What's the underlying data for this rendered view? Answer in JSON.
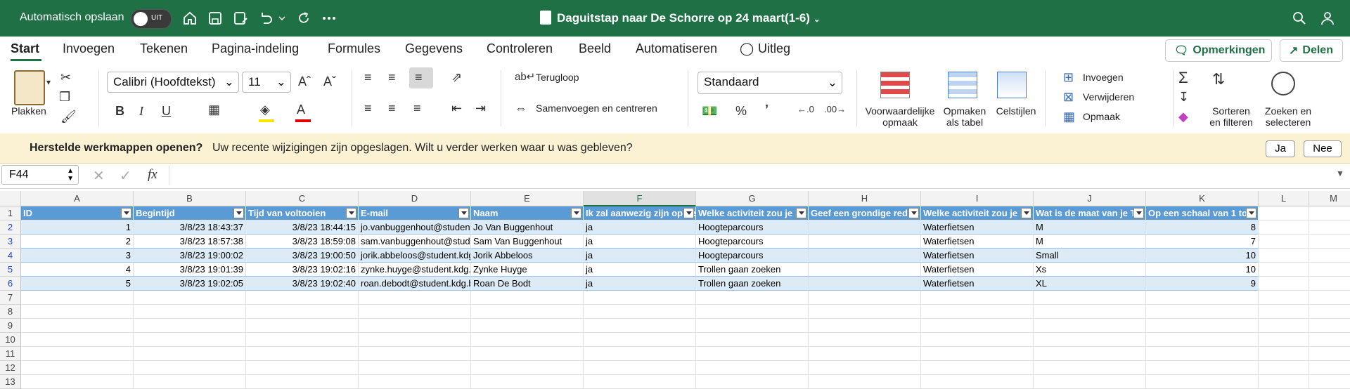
{
  "titlebar": {
    "autosave_label": "Automatisch opslaan",
    "toggle_state": "UIT",
    "doc_title": "Daguitstap naar De Schorre op 24 maart(1-6)"
  },
  "menu": {
    "tabs": [
      "Start",
      "Invoegen",
      "Tekenen",
      "Pagina-indeling",
      "Formules",
      "Gegevens",
      "Controleren",
      "Beeld",
      "Automatiseren",
      "Uitleg"
    ],
    "comments_label": "Opmerkingen",
    "share_label": "Delen"
  },
  "ribbon": {
    "paste_label": "Plakken",
    "font_name": "Calibri (Hoofdtekst)",
    "font_size": "11",
    "wrap_label": "Terugloop",
    "merge_label": "Samenvoegen en centreren",
    "number_format": "Standaard",
    "cond_format_label": "Voorwaardelijke opmaak",
    "table_format_label": "Opmaken als tabel",
    "cell_styles_label": "Celstijlen",
    "insert_label": "Invoegen",
    "delete_label": "Verwijderen",
    "format_label": "Opmaak",
    "sort_filter_label": "Sorteren en filteren",
    "find_select_label": "Zoeken en selecteren"
  },
  "infobar": {
    "title": "Herstelde werkmappen openen?",
    "message": "Uw recente wijzigingen zijn opgeslagen. Wilt u verder werken waar u was gebleven?",
    "yes": "Ja",
    "no": "Nee"
  },
  "formula": {
    "namebox": "F44",
    "fx": "fx"
  },
  "sheet": {
    "columns": [
      "A",
      "B",
      "C",
      "D",
      "E",
      "F",
      "G",
      "H",
      "I",
      "J",
      "K",
      "L",
      "M"
    ],
    "selected_column": "F",
    "rows": [
      "1",
      "2",
      "3",
      "4",
      "5",
      "6",
      "7",
      "8",
      "9",
      "10",
      "11",
      "12",
      "13"
    ],
    "headers": [
      "ID",
      "Begintijd",
      "Tijd van voltooien",
      "E-mail",
      "Naam",
      "Ik zal aanwezig zijn op de",
      "Welke activiteit zou je",
      "Geef een grondige red",
      "Welke activiteit zou je",
      "Wat is de maat van je T",
      "Op een schaal van 1 to"
    ],
    "data": [
      [
        "1",
        "3/8/23 18:43:37",
        "3/8/23 18:44:15",
        "jo.vanbuggenhout@student.kdg.be",
        "Jo Van Buggenhout",
        "ja",
        "Hoogteparcours",
        "",
        "Waterfietsen",
        "M",
        "8"
      ],
      [
        "2",
        "3/8/23 18:57:38",
        "3/8/23 18:59:08",
        "sam.vanbuggenhout@student.kdg.be",
        "Sam Van Buggenhout",
        "ja",
        "Hoogteparcours",
        "",
        "Waterfietsen",
        "M",
        "7"
      ],
      [
        "3",
        "3/8/23 19:00:02",
        "3/8/23 19:00:50",
        "jorik.abbeloos@student.kdg.be",
        "Jorik Abbeloos",
        "ja",
        "Hoogteparcours",
        "",
        "Waterfietsen",
        "Small",
        "10"
      ],
      [
        "4",
        "3/8/23 19:01:39",
        "3/8/23 19:02:16",
        "zynke.huyge@student.kdg.be",
        "Zynke Huyge",
        "ja",
        "Trollen gaan zoeken",
        "",
        "Waterfietsen",
        "Xs",
        "10"
      ],
      [
        "5",
        "3/8/23 19:02:05",
        "3/8/23 19:02:40",
        "roan.debodt@student.kdg.be",
        "Roan De Bodt",
        "ja",
        "Trollen gaan zoeken",
        "",
        "Waterfietsen",
        "XL",
        "9"
      ]
    ]
  }
}
